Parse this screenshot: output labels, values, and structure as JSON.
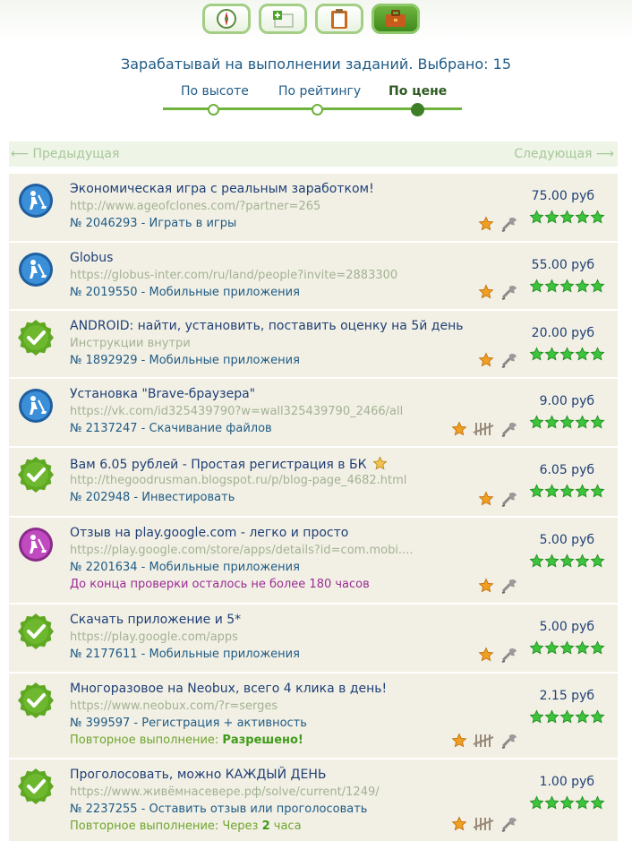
{
  "heading": "Зарабатывай на выполнении заданий. Выбрано: 15",
  "sorts": [
    "По высоте",
    "По рейтингу",
    "По цене"
  ],
  "pager": {
    "prev": "⟵ Предыдущая",
    "next": "Следующая ⟶"
  },
  "colors": {
    "accent": "#6fb33f",
    "link": "#1f5b86",
    "row_bg": "#f2f0e4"
  },
  "nav_icons": [
    "compass-icon",
    "add-task-icon",
    "clipboard-icon",
    "briefcase-icon"
  ],
  "tasks": [
    {
      "title": "Экономическая игра с реальным заработком!",
      "url": "http://www.ageofclones.com/?partner=265",
      "num": "№ 2046293 - Играть в игры",
      "price": "75.00 руб",
      "badge": "worker-blue",
      "rating": 5
    },
    {
      "title": "Globus",
      "url": "https://globus-inter.com/ru/land/people?invite=2883300",
      "num": "№ 2019550 - Мобильные приложения",
      "price": "55.00 руб",
      "badge": "worker-blue",
      "rating": 5
    },
    {
      "title": "ANDROID: найти, установить, поставить оценку на 5й день",
      "url": "Инструкции внутри",
      "num": "№ 1892929 - Мобильные приложения",
      "price": "20.00 руб",
      "badge": "check-green",
      "rating": 5
    },
    {
      "title": "Установка \"Brave-браузера\"",
      "url": "https://vk.com/id325439790?w=wall325439790_2466/all",
      "num": "№ 2137247 - Скачивание файлов",
      "price": "9.00 руб",
      "badge": "worker-blue",
      "rating": 5
    },
    {
      "title": "Вам 6.05 рублей - Простая регистрация в БК",
      "url": "http://thegoodrusman.blogspot.ru/p/blog-page_4682.html",
      "num": "№ 202948 - Инвестировать",
      "price": "6.05 руб",
      "badge": "check-green",
      "rating": 5
    },
    {
      "title": "Отзыв на play.google.com - легко и просто",
      "url": "https://play.google.com/store/apps/details?id=com.mobi....",
      "num": "№ 2201634 - Мобильные приложения",
      "note": "До конца проверки осталось не более 180 часов",
      "price": "5.00 руб",
      "badge": "worker-purple",
      "rating": 5
    },
    {
      "title": "Скачать приложение и 5*",
      "url": "https://play.google.com/apps",
      "num": "№ 2177611 - Мобильные приложения",
      "price": "5.00 руб",
      "badge": "check-green",
      "rating": 5
    },
    {
      "title": "Многоразовое на Neobux, всего 4 клика в день!",
      "url": "https://www.neobux.com/?r=serges",
      "num": "№ 399597 - Регистрация + активность",
      "note_label": "Повторное выполнение:",
      "note_value": "Разрешено!",
      "price": "2.15 руб",
      "badge": "check-green",
      "rating": 5
    },
    {
      "title": "Проголосовать, можно КАЖДЫЙ ДЕНЬ",
      "url": "https://www.живёмнасевере.рф/solve/current/1249/",
      "num": "№ 2237255 - Оставить отзыв или проголосовать",
      "note_label": "Повторное выполнение: Через",
      "note_value": "2",
      "note_suffix": "часа",
      "price": "1.00 руб",
      "badge": "check-green",
      "rating": 5
    }
  ]
}
